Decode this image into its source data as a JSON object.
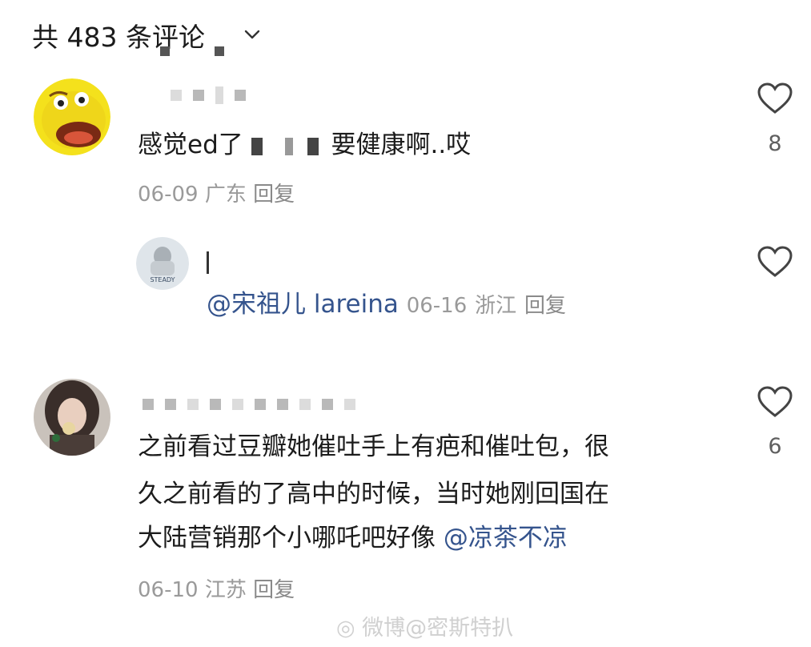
{
  "header": {
    "title": "共 483 条评论"
  },
  "comments": [
    {
      "text_start": "感觉ed了",
      "text_end": "要健康啊..哎",
      "date": "06-09",
      "location": "广东",
      "reply_label": "回复",
      "likes": "8"
    },
    {
      "mention": "@宋祖儿 lareina",
      "date": "06-16",
      "location": "浙江",
      "reply_label": "回复",
      "avatar_text": "STEADY"
    },
    {
      "lines": [
        "之前看过豆瓣她催吐手上有疤和催吐包，很",
        "久之前看的了高中的时候，当时她刚回国在",
        "大陆营销那个小哪吒吧好像"
      ],
      "mention": "@凉茶不凉",
      "date": "06-10",
      "location": "江苏",
      "reply_label": "回复",
      "likes": "6"
    }
  ],
  "watermark": "微博@密斯特扒",
  "icons": [
    "chevron-down-icon",
    "heart-icon",
    "weibo-logo"
  ]
}
